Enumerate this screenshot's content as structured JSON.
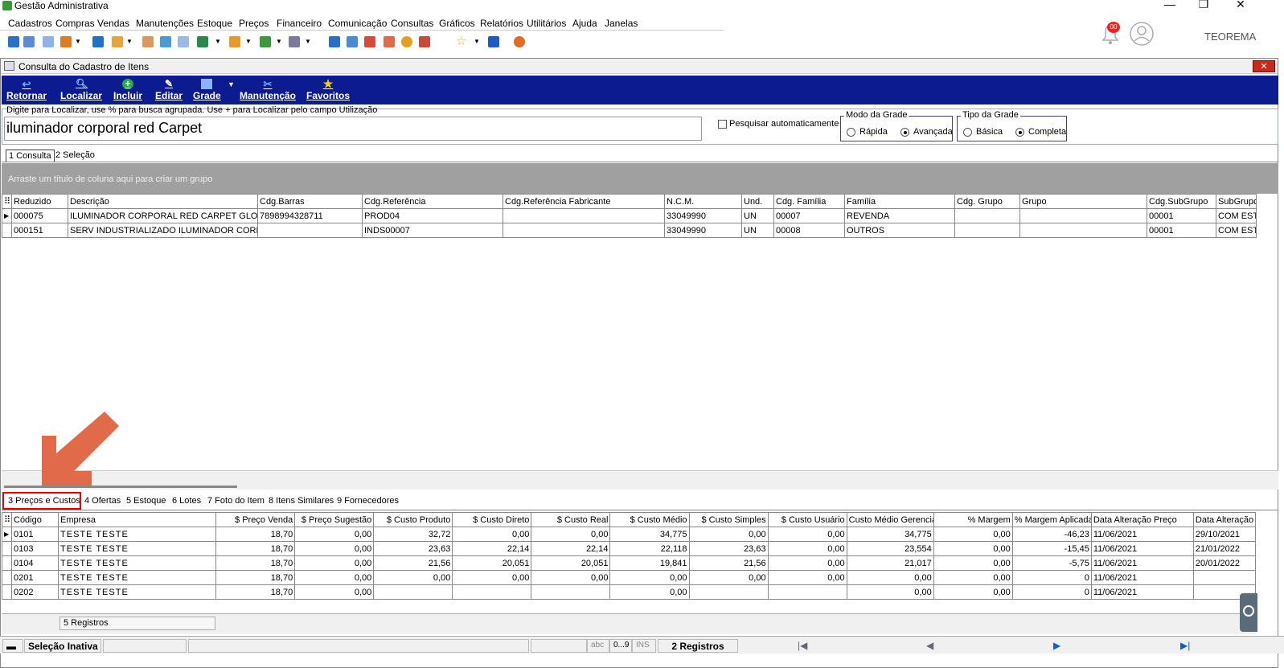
{
  "window": {
    "title": "Gestão Administrativa"
  },
  "menu": [
    "Cadastros",
    "Compras",
    "Vendas",
    "Manutenções",
    "Estoque",
    "Preços",
    "Financeiro",
    "Comunicação",
    "Consultas",
    "Gráficos",
    "Relatórios",
    "Utilitários",
    "Ajuda",
    "Janelas"
  ],
  "notifications": {
    "count": "00"
  },
  "user": {
    "name": "TEOREMA"
  },
  "inner_window": {
    "title": "Consulta do Cadastro de Itens",
    "close": "✕"
  },
  "actions": [
    "Retornar",
    "Localizar",
    "Incluir",
    "Editar",
    "Grade",
    "Manutenção",
    "Favoritos"
  ],
  "search": {
    "hint": "Digite para Localizar, use % para busca agrupada. Use + para Localizar pelo campo Utilização",
    "value": "iluminador corporal red Carpet",
    "auto_label": "Pesquisar automaticamente"
  },
  "grid_mode": {
    "title": "Modo da Grade",
    "options": [
      "Rápida",
      "Avançada"
    ],
    "selected": "Avançada"
  },
  "grid_type": {
    "title": "Tipo da Grade",
    "options": [
      "Básica",
      "Completa"
    ],
    "selected": "Completa"
  },
  "top_tabs": [
    "1 Consulta",
    "2 Seleção"
  ],
  "group_hint": "Arraste um título de coluna aqui para criar um grupo",
  "items_table": {
    "columns": [
      "Reduzido",
      "Descrição",
      "Cdg.Barras",
      "Cdg.Referência",
      "Cdg.Referência Fabricante",
      "N.C.M.",
      "Und.",
      "Cdg. Família",
      "Família",
      "Cdg. Grupo",
      "Grupo",
      "Cdg.SubGrupo",
      "SubGrupo"
    ],
    "rows": [
      [
        "000075",
        "ILUMINADOR CORPORAL RED CARPET GLOW",
        "7898994328711",
        "PROD04",
        "",
        "33049990",
        "UN",
        "00007",
        "REVENDA",
        "",
        "",
        "00001",
        "COM EST"
      ],
      [
        "000151",
        "SERV INDUSTRIALIZADO ILUMINADOR CORPORAL",
        "",
        "INDS00007",
        "",
        "33049990",
        "UN",
        "00008",
        "OUTROS",
        "",
        "",
        "00001",
        "COM EST"
      ]
    ]
  },
  "bottom_tabs": [
    "3 Preços e Custos",
    "4 Ofertas",
    "5 Estoque",
    "6 Lotes",
    "7 Foto do Item",
    "8 Itens Similares",
    "9 Fornecedores"
  ],
  "prices_table": {
    "columns": [
      "Código",
      "Empresa",
      "$ Preço Venda",
      "$ Preço Sugestão",
      "$ Custo Produto",
      "$ Custo Direto",
      "$ Custo Real",
      "$ Custo Médio",
      "$ Custo Simples",
      "$ Custo Usuário",
      "Custo Médio Gerencial",
      "% Margem",
      "% Margem Aplicada",
      "Data Alteração Preço",
      "Data Alteração"
    ],
    "rows": [
      [
        "0101",
        "TESTE TESTE",
        "18,70",
        "0,00",
        "32,72",
        "0,00",
        "0,00",
        "34,775",
        "0,00",
        "0,00",
        "34,775",
        "0,00",
        "-46,23",
        "11/06/2021",
        "29/10/2021"
      ],
      [
        "0103",
        "TESTE TESTE",
        "18,70",
        "0,00",
        "23,63",
        "22,14",
        "22,14",
        "22,118",
        "23,63",
        "0,00",
        "23,554",
        "0,00",
        "-15,45",
        "11/06/2021",
        "21/01/2022"
      ],
      [
        "0104",
        "TESTE TESTE",
        "18,70",
        "0,00",
        "21,56",
        "20,051",
        "20,051",
        "19,841",
        "21,56",
        "0,00",
        "21,017",
        "0,00",
        "-5,75",
        "11/06/2021",
        "20/01/2022"
      ],
      [
        "0201",
        "TESTE TESTE",
        "18,70",
        "0,00",
        "0,00",
        "0,00",
        "0,00",
        "0,00",
        "0,00",
        "0,00",
        "0,00",
        "0,00",
        "0",
        "11/06/2021",
        ""
      ],
      [
        "0202",
        "TESTE TESTE",
        "18,70",
        "0,00",
        "",
        "",
        "",
        "0,00",
        "",
        "",
        "0,00",
        "0,00",
        "0",
        "11/06/2021",
        ""
      ]
    ],
    "record_count": "5 Registros"
  },
  "status": {
    "selection": "Seleção Inativa",
    "abc": "abc",
    "digits": "0...9",
    "ins": "INS",
    "records": "2 Registros"
  }
}
